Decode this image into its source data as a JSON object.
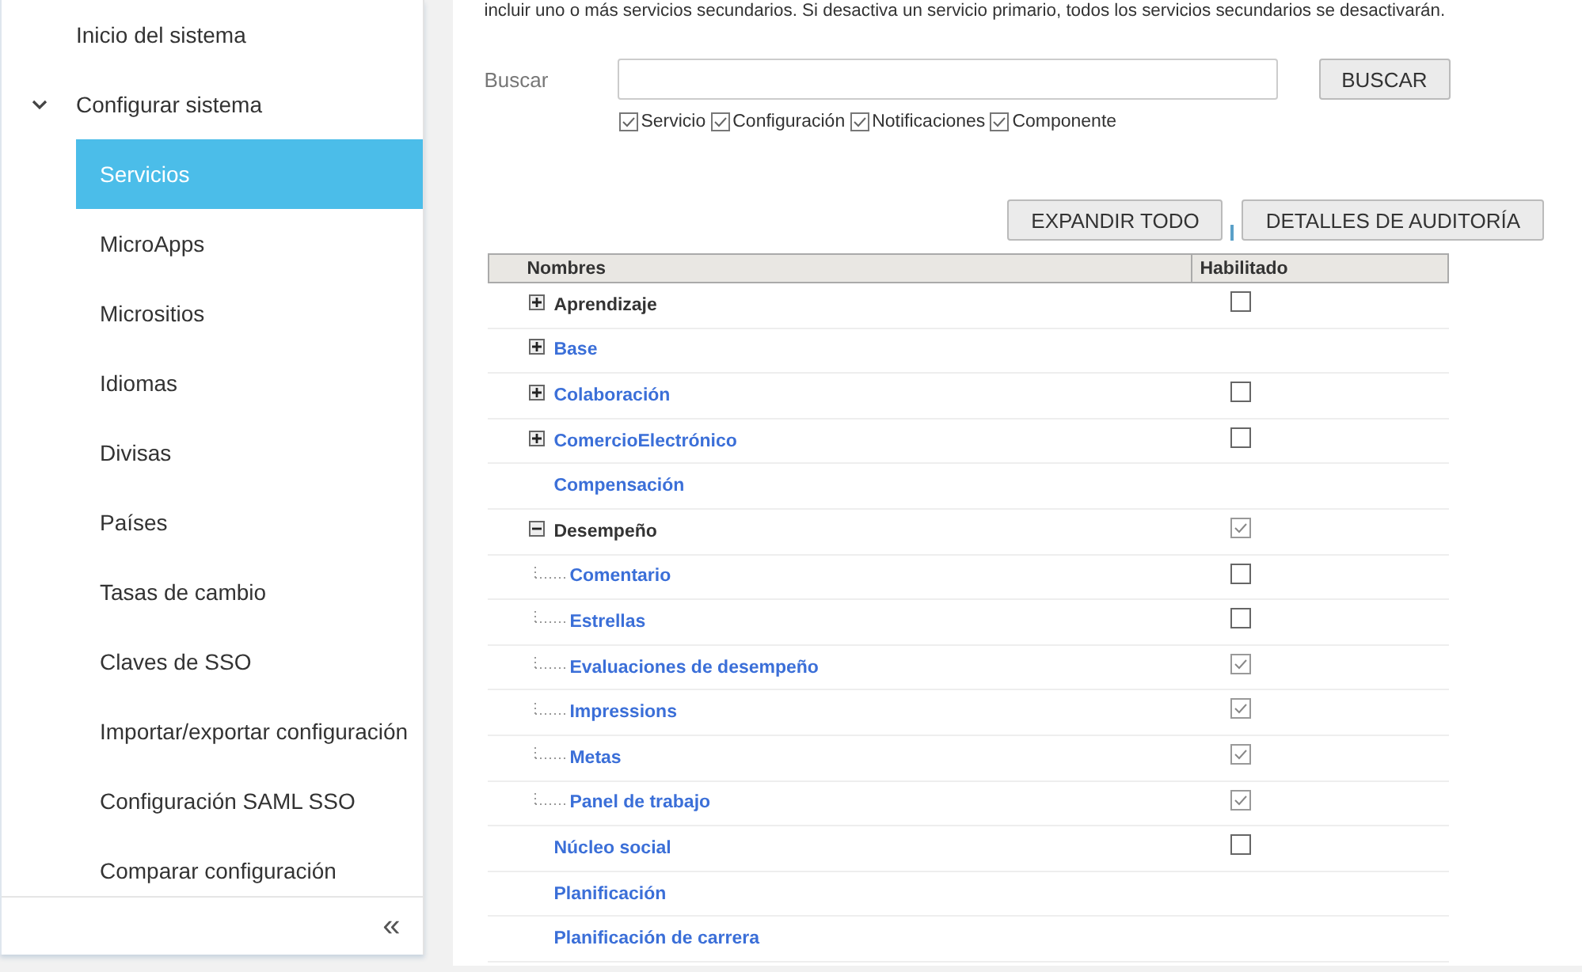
{
  "sidebar": {
    "items": [
      {
        "label": "Inicio del sistema"
      },
      {
        "label": "Configurar sistema",
        "expanded": true,
        "children": [
          {
            "label": "Servicios",
            "selected": true
          },
          {
            "label": "MicroApps",
            "selected": false
          },
          {
            "label": "Micrositios",
            "selected": false
          },
          {
            "label": "Idiomas",
            "selected": false
          },
          {
            "label": "Divisas",
            "selected": false
          },
          {
            "label": "Países",
            "selected": false
          },
          {
            "label": "Tasas de cambio",
            "selected": false
          },
          {
            "label": "Claves de SSO",
            "selected": false
          },
          {
            "label": "Importar/exportar configuración",
            "selected": false
          },
          {
            "label": "Configuración SAML SSO",
            "selected": false
          },
          {
            "label": "Comparar configuración",
            "selected": false
          }
        ]
      }
    ],
    "collapse": "«"
  },
  "description": "incluir uno o más servicios secundarios. Si desactiva un servicio primario, todos los servicios secundarios se desactivarán.",
  "search": {
    "label": "Buscar",
    "button": "BUSCAR"
  },
  "filters": [
    {
      "label": "Servicio",
      "checked": true
    },
    {
      "label": "Configuración",
      "checked": true
    },
    {
      "label": "Notificaciones",
      "checked": true
    },
    {
      "label": "Componente",
      "checked": true
    }
  ],
  "actions": [
    "EXPANDIR TODO",
    "DETALLES DE AUDITORÍA"
  ],
  "table": {
    "columns": [
      "Nombres",
      "Habilitado"
    ],
    "rows": [
      {
        "name": "Aprendizaje",
        "kind": "primary",
        "expanded": false,
        "enabled": false
      },
      {
        "name": "Base",
        "kind": "link",
        "expanded": false
      },
      {
        "name": "Colaboración",
        "kind": "link",
        "expanded": false,
        "enabled": false
      },
      {
        "name": "ComercioElectrónico",
        "kind": "link",
        "expanded": false,
        "enabled": false
      },
      {
        "name": "Compensación",
        "kind": "link"
      },
      {
        "name": "Desempeño",
        "kind": "primary",
        "expanded": true,
        "enabled": true,
        "children": [
          {
            "name": "Comentario",
            "kind": "link",
            "enabled": false
          },
          {
            "name": "Estrellas",
            "kind": "link",
            "enabled": false
          },
          {
            "name": "Evaluaciones de desempeño",
            "kind": "link",
            "enabled": true
          },
          {
            "name": "Impressions",
            "kind": "link",
            "enabled": true
          },
          {
            "name": "Metas",
            "kind": "link",
            "enabled": true
          },
          {
            "name": "Panel de trabajo",
            "kind": "link",
            "enabled": true
          }
        ]
      },
      {
        "name": "Núcleo social",
        "kind": "link",
        "enabled": false
      },
      {
        "name": "Planificación",
        "kind": "link"
      },
      {
        "name": "Planificación de carrera",
        "kind": "link"
      }
    ]
  }
}
